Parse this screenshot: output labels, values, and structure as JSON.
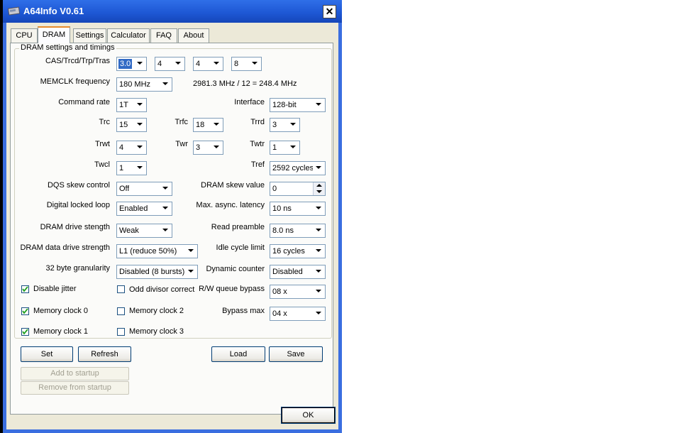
{
  "window": {
    "title": "A64Info V0.61",
    "close_glyph": "✕",
    "icon": "app-card-icon"
  },
  "tabs": [
    {
      "label": "CPU",
      "active": false
    },
    {
      "label": "DRAM",
      "active": true
    },
    {
      "label": "Settings",
      "active": false
    },
    {
      "label": "Calculator",
      "active": false
    },
    {
      "label": "FAQ",
      "active": false
    },
    {
      "label": "About",
      "active": false
    }
  ],
  "group": {
    "title": "DRAM settings and timings"
  },
  "timings": {
    "cas_label": "CAS/Trcd/Trp/Tras",
    "cas": "3.0",
    "trcd": "4",
    "trp": "4",
    "tras": "8",
    "memclk_label": "MEMCLK frequency",
    "memclk": "180 MHz",
    "memclk_info": "2981.3 MHz / 12 = 248.4 MHz",
    "command_rate_label": "Command rate",
    "command_rate": "1T",
    "interface_label": "Interface",
    "interface": "128-bit",
    "trc_label": "Trc",
    "trc": "15",
    "trfc_label": "Trfc",
    "trfc": "18",
    "trrd_label": "Trrd",
    "trrd": "3",
    "trwt_label": "Trwt",
    "trwt": "4",
    "twr_label": "Twr",
    "twr": "3",
    "twtr_label": "Twtr",
    "twtr": "1",
    "twcl_label": "Twcl",
    "twcl": "1",
    "tref_label": "Tref",
    "tref": "2592 cycles",
    "dqs_label": "DQS skew control",
    "dqs": "Off",
    "dram_skew_label": "DRAM skew value",
    "dram_skew": "0",
    "dll_label": "Digital locked loop",
    "dll": "Enabled",
    "async_label": "Max. async. latency",
    "async": "10 ns",
    "drive_label": "DRAM drive stength",
    "drive": "Weak",
    "preamble_label": "Read preamble",
    "preamble": "8.0 ns",
    "data_drive_label": "DRAM data drive strength",
    "data_drive": "L1 (reduce 50%)",
    "idle_label": "Idle cycle limit",
    "idle": "16 cycles",
    "gran_label": "32 byte granularity",
    "gran": "Disabled (8 bursts)",
    "dyn_label": "Dynamic counter",
    "dyn": "Disabled",
    "rw_label": "R/W queue bypass",
    "rw": "08 x",
    "bypass_label": "Bypass max",
    "bypass": "04 x"
  },
  "checkboxes": {
    "disable_jitter": {
      "label": "Disable jitter",
      "checked": true
    },
    "odd_divisor": {
      "label": "Odd divisor correct",
      "checked": false
    },
    "memclk0": {
      "label": "Memory clock 0",
      "checked": true
    },
    "memclk2": {
      "label": "Memory clock 2",
      "checked": false
    },
    "memclk1": {
      "label": "Memory clock 1",
      "checked": true
    },
    "memclk3": {
      "label": "Memory clock 3",
      "checked": false
    }
  },
  "buttons": {
    "set": "Set",
    "refresh": "Refresh",
    "load": "Load",
    "save": "Save",
    "add_startup": "Add to startup",
    "remove_startup": "Remove from startup",
    "ok": "OK"
  },
  "colors": {
    "titlebar": "#1d56d3",
    "dialog": "#ece9d8",
    "selection": "#316ac5",
    "tab_highlight": "#e68b2c"
  }
}
